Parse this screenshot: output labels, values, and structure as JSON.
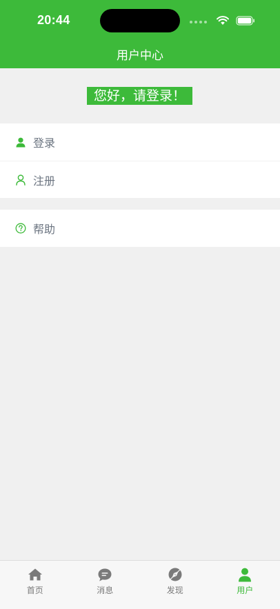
{
  "status_bar": {
    "time": "20:44"
  },
  "header": {
    "title": "用户中心"
  },
  "greeting": "您好，请登录！",
  "menu": {
    "group1": [
      {
        "label": "登录",
        "icon": "user-filled-icon"
      },
      {
        "label": "注册",
        "icon": "user-outline-icon"
      }
    ],
    "group2": [
      {
        "label": "帮助",
        "icon": "help-circle-icon"
      }
    ]
  },
  "tabbar": {
    "items": [
      {
        "label": "首页",
        "icon": "home-icon",
        "active": false
      },
      {
        "label": "消息",
        "icon": "message-icon",
        "active": false
      },
      {
        "label": "发现",
        "icon": "discover-icon",
        "active": false
      },
      {
        "label": "用户",
        "icon": "user-icon",
        "active": true
      }
    ]
  },
  "colors": {
    "brand": "#3dba3a",
    "background": "#f0f0f0",
    "text_gray": "#6b7480",
    "tab_inactive": "#7a7a7a"
  }
}
